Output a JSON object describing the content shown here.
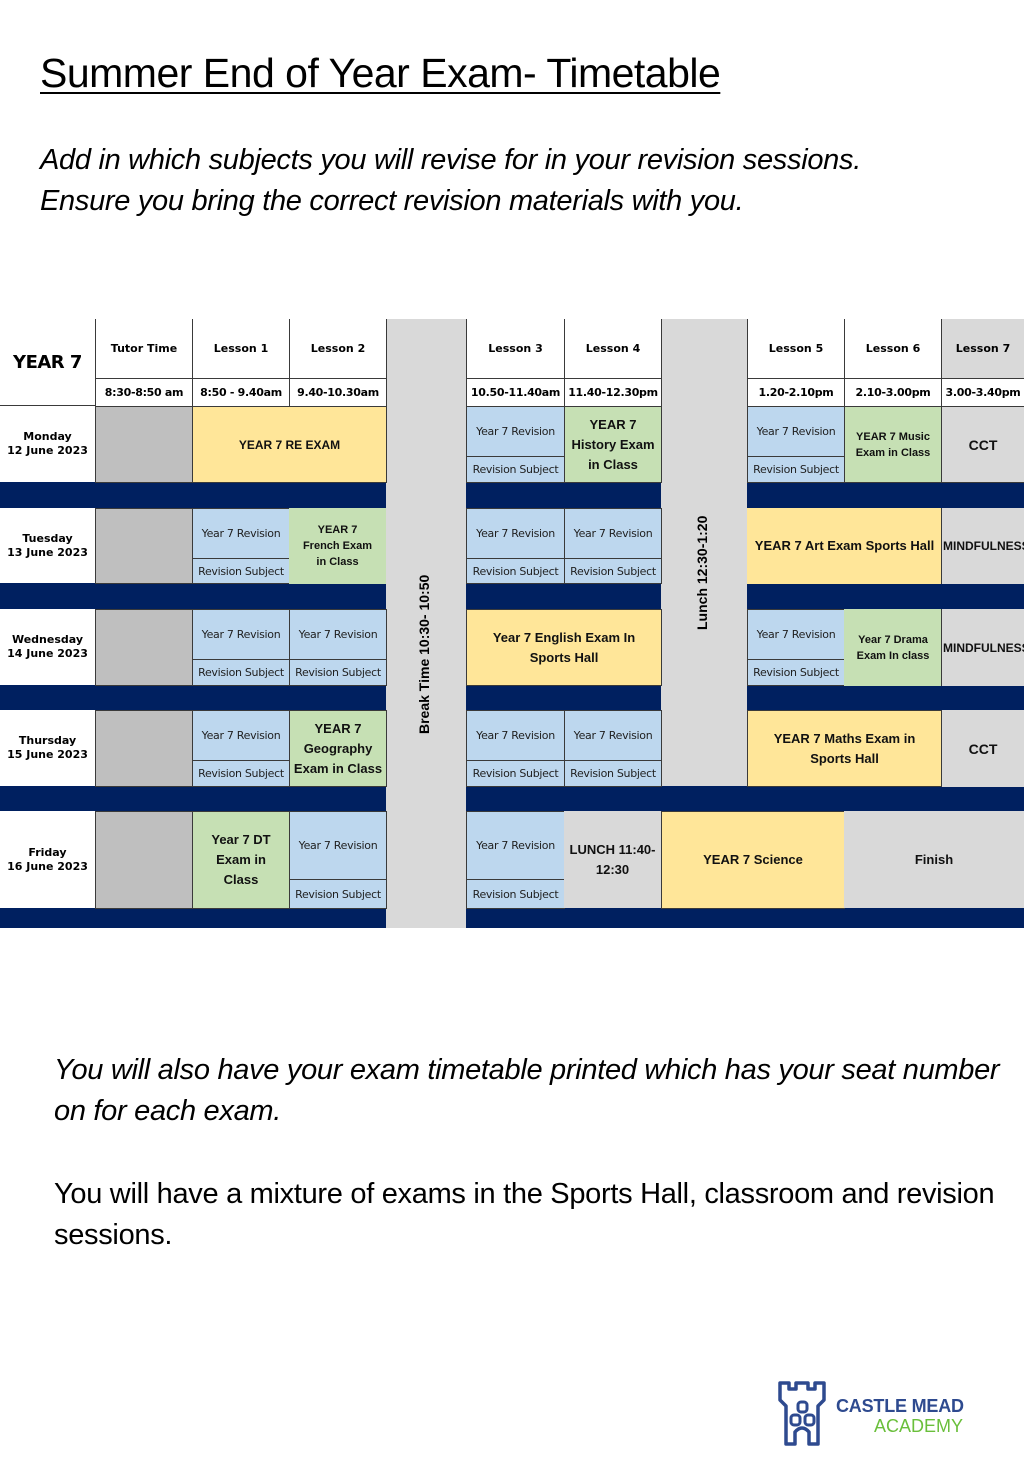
{
  "page": {
    "title": "Summer End of Year Exam- Timetable",
    "intro_line1": "Add in which subjects you will revise for in your revision sessions.",
    "intro_line2": "Ensure you bring the correct revision materials with you.",
    "note1": "You will also have your exam timetable printed which has your seat number on for each exam.",
    "note2": "You will have a mixture of exams in the Sports Hall, classroom and revision sessions."
  },
  "colors": {
    "exam_sports_hall": "#ffe699",
    "exam_in_class": "#c6e0b4",
    "revision": "#bdd7ee",
    "separator": "#002060",
    "break": "#d9d9d9",
    "tutor": "#bfbfbf"
  },
  "timetable": {
    "year_label": "YEAR 7",
    "columns": [
      {
        "label": "Tutor Time",
        "time": "8:30-8:50 am"
      },
      {
        "label": "Lesson 1",
        "time": "8:50 - 9.40am"
      },
      {
        "label": "Lesson 2",
        "time": "9.40-10.30am"
      },
      {
        "label": "Lesson 3",
        "time": "10.50-11.40am"
      },
      {
        "label": "Lesson 4",
        "time": "11.40-12.30pm"
      },
      {
        "label": "Lesson 5",
        "time": "1.20-2.10pm"
      },
      {
        "label": "Lesson 6",
        "time": "2.10-3.00pm"
      },
      {
        "label": "Lesson 7",
        "time": "3.00-3.40pm"
      }
    ],
    "break_label": "Break Time 10:30- 10:50",
    "lunch_label": "Lunch 12:30-1:20",
    "revision_label": "Year 7 Revision",
    "revision_subject_label": "Revision Subject",
    "days": [
      {
        "day": "Monday",
        "date": "12 June 2023",
        "l1_l2": "YEAR 7 RE  EXAM",
        "l4": "YEAR 7 History Exam in Class",
        "l6": "YEAR 7 Music Exam in Class",
        "l7": "CCT"
      },
      {
        "day": "Tuesday",
        "date": "13 June 2023",
        "l2": "YEAR 7 French Exam in Class",
        "l5_l6": "YEAR 7 Art Exam Sports Hall",
        "l7": "MINDFULNESS"
      },
      {
        "day": "Wednesday",
        "date": "14 June 2023",
        "l3_l4": "Year 7 English Exam In Sports Hall",
        "l6": "Year 7 Drama Exam In class",
        "l7": "MINDFULNESS"
      },
      {
        "day": "Thursday",
        "date": "15 June 2023",
        "l2": "YEAR 7 Geography Exam in Class",
        "l5_l6": "YEAR 7 Maths Exam in Sports Hall",
        "l7": "CCT"
      },
      {
        "day": "Friday",
        "date": "16 June 2023",
        "l1": "Year 7 DT Exam in Class",
        "l4": "LUNCH 11:40- 12:30",
        "lunch_l5": "YEAR 7 Science",
        "l6_l7": "Finish"
      }
    ]
  },
  "logo": {
    "name_line1": "CASTLE MEAD",
    "name_line2": "ACADEMY"
  }
}
